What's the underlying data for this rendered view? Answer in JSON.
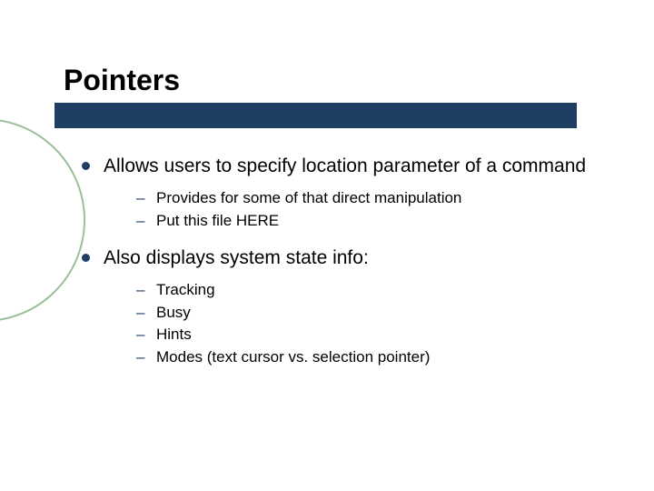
{
  "title": "Pointers",
  "bullets": [
    {
      "text": "Allows users to specify location parameter of a command",
      "sub": [
        "Provides for some of that direct manipulation",
        "Put this file HERE"
      ]
    },
    {
      "text": "Also displays system state info:",
      "sub": [
        "Tracking",
        "Busy",
        "Hints",
        "Modes (text cursor vs. selection pointer)"
      ]
    }
  ]
}
